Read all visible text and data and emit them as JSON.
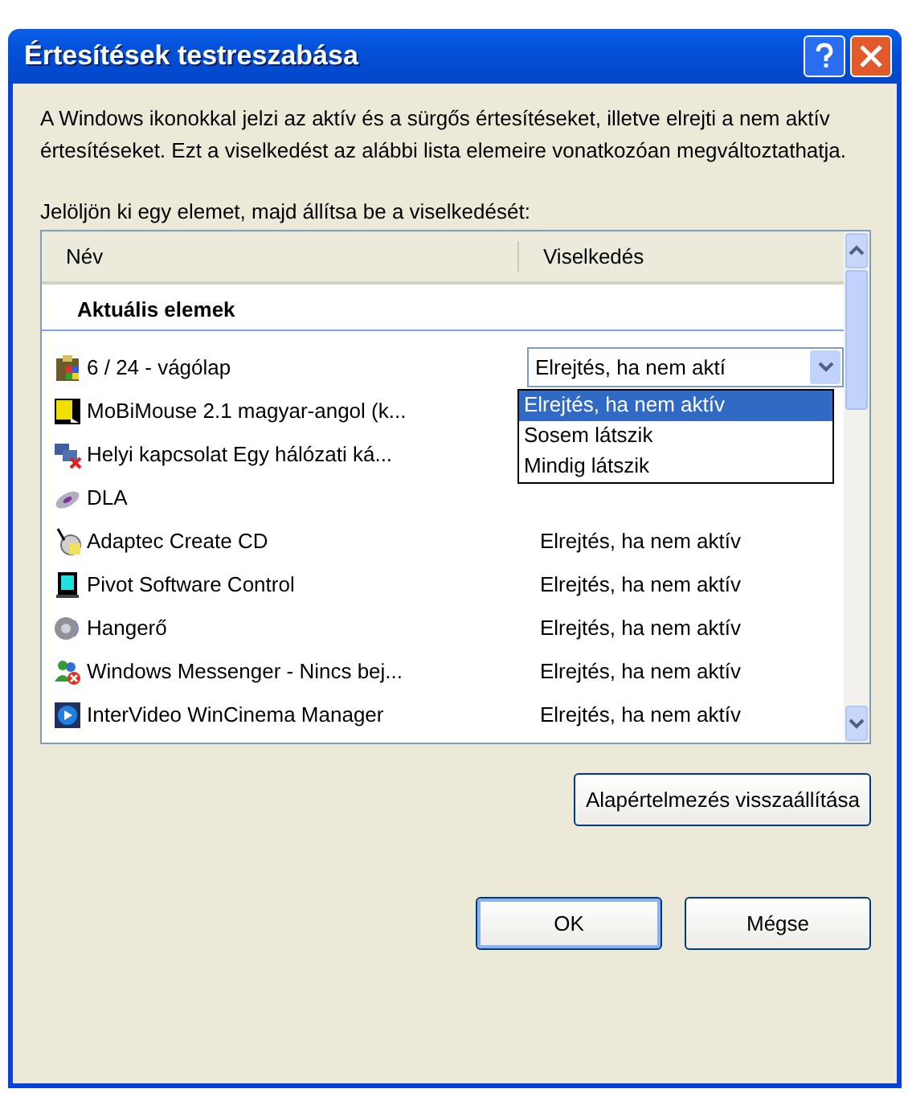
{
  "window": {
    "title": "Értesítések testreszabása"
  },
  "description": "A Windows ikonokkal jelzi az aktív és a sürgős értesítéseket, illetve elrejti a nem aktív értesítéseket. Ezt a viselkedést az alábbi lista elemeire vonatkozóan megváltoztathatja.",
  "prompt": "Jelöljön ki egy elemet, majd állítsa be a viselkedését:",
  "list": {
    "columns": [
      "Név",
      "Viselkedés"
    ],
    "group": "Aktuális elemek",
    "rows": [
      {
        "kind": "combo",
        "name": "6 / 24 - vágólap",
        "behavior": "Elrejtés, ha nem aktí",
        "dropdown": [
          {
            "label": "Elrejtés, ha nem aktív",
            "selected": true
          },
          {
            "label": "Sosem látszik",
            "selected": false
          },
          {
            "label": "Mindig látszik",
            "selected": false
          }
        ]
      },
      {
        "kind": "text",
        "name": "MoBiMouse 2.1 magyar-angol (k..."
      },
      {
        "kind": "text",
        "name": "Helyi kapcsolat Egy hálózati ká..."
      },
      {
        "kind": "text",
        "name": "DLA"
      },
      {
        "kind": "text",
        "name": "Adaptec Create CD",
        "behavior": "Elrejtés, ha nem aktív"
      },
      {
        "kind": "text",
        "name": "Pivot Software Control",
        "behavior": "Elrejtés, ha nem aktív"
      },
      {
        "kind": "text",
        "name": "Hangerő",
        "behavior": "Elrejtés, ha nem aktív"
      },
      {
        "kind": "text",
        "name": "Windows Messenger - Nincs bej...",
        "behavior": "Elrejtés, ha nem aktív"
      },
      {
        "kind": "text",
        "name": "InterVideo WinCinema Manager",
        "behavior": "Elrejtés, ha nem aktív"
      }
    ]
  },
  "buttons": [
    {
      "kind": "restore",
      "label": "Alapértelmezés visszaállítása"
    },
    {
      "kind": "ok",
      "label": "OK"
    },
    {
      "kind": "cancel",
      "label": "Mégse"
    }
  ]
}
